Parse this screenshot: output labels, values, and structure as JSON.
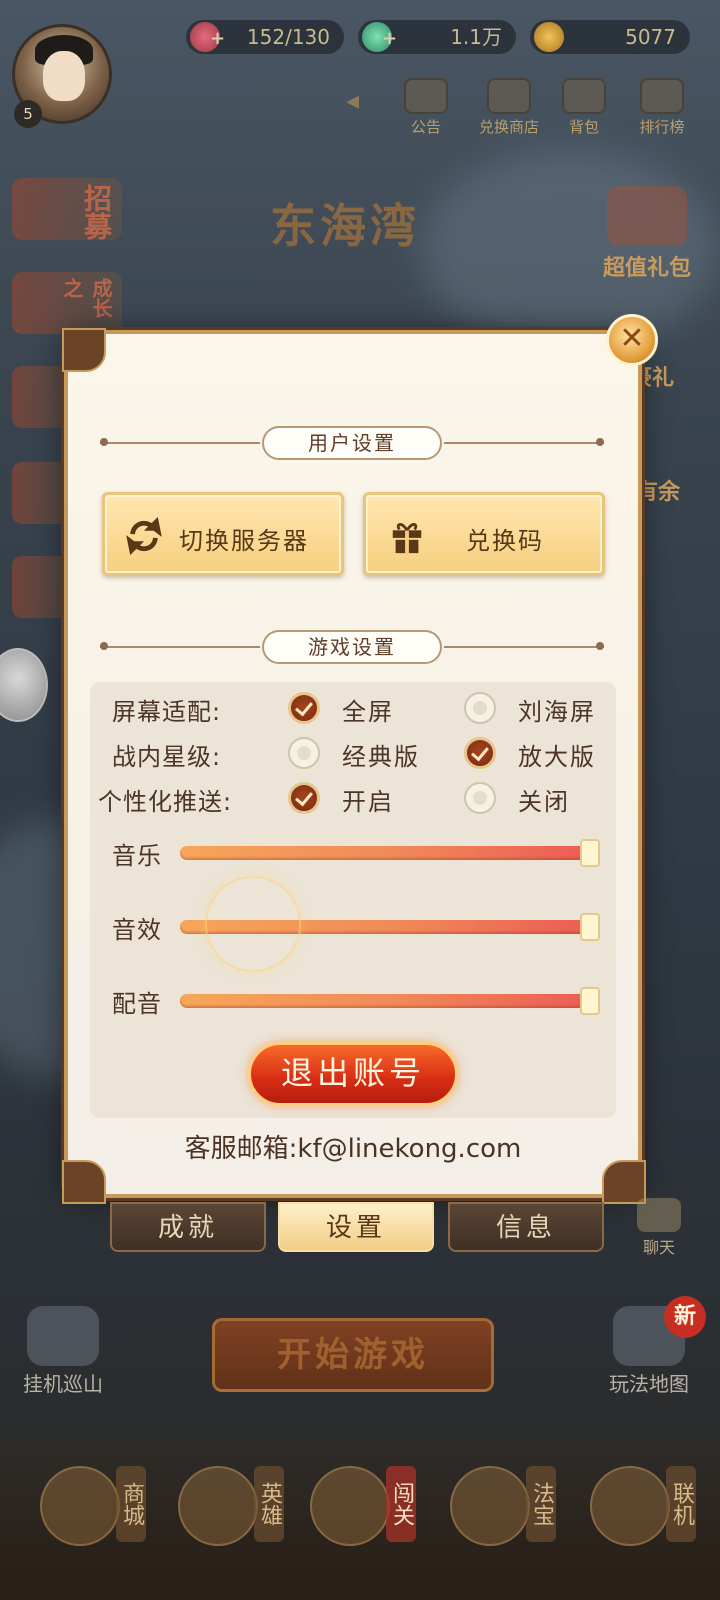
{
  "hud": {
    "level": "5",
    "stamina": "152/130",
    "gems": "1.1万",
    "coins": "5077"
  },
  "top_nav": [
    {
      "label": "公告",
      "icon": "notice-board-icon"
    },
    {
      "label": "兑换商店",
      "icon": "exchange-shop-icon"
    },
    {
      "label": "背包",
      "icon": "backpack-icon"
    },
    {
      "label": "排行榜",
      "icon": "ranking-icon"
    }
  ],
  "left_menu": [
    {
      "label": "招募"
    },
    {
      "label": "成长之"
    }
  ],
  "map_title": "东海湾",
  "right_menu": [
    {
      "label": "超值礼包"
    },
    {
      "label": "豪礼"
    },
    {
      "label": "有余"
    }
  ],
  "panel": {
    "close_label": "✕",
    "user_section_title": "用户设置",
    "switch_server_label": "切换服务器",
    "redeem_code_label": "兑换码",
    "game_section_title": "游戏设置",
    "rows": [
      {
        "label": "屏幕适配:",
        "opt1": "全屏",
        "opt1_checked": true,
        "opt2": "刘海屏",
        "opt2_checked": false
      },
      {
        "label": "战内星级:",
        "opt1": "经典版",
        "opt1_checked": false,
        "opt2": "放大版",
        "opt2_checked": true
      },
      {
        "label": "个性化推送:",
        "opt1": "开启",
        "opt1_checked": true,
        "opt2": "关闭",
        "opt2_checked": false
      }
    ],
    "sliders": [
      {
        "label": "音乐",
        "value": 1.0
      },
      {
        "label": "音效",
        "value": 1.0
      },
      {
        "label": "配音",
        "value": 1.0
      }
    ],
    "logout_label": "退出账号",
    "email_text": "客服邮箱:kf@linekong.com"
  },
  "tabs": [
    {
      "label": "成就",
      "active": false
    },
    {
      "label": "设置",
      "active": true
    },
    {
      "label": "信息",
      "active": false
    }
  ],
  "chat_label": "聊天",
  "start_game_label": "开始游戏",
  "bottom_left_label": "挂机巡山",
  "bottom_right_label": "玩法地图",
  "new_badge": "新",
  "bottom_nav": [
    {
      "label": "商城",
      "active": false
    },
    {
      "label": "英雄",
      "active": false
    },
    {
      "label": "闯关",
      "active": true
    },
    {
      "label": "法宝",
      "active": false
    },
    {
      "label": "联机",
      "active": false
    }
  ],
  "colors": {
    "panel_border": "#c89a5a",
    "accent_red": "#d72c14",
    "gold_button": "#f7cf7f",
    "text_brown": "#4d3526"
  }
}
